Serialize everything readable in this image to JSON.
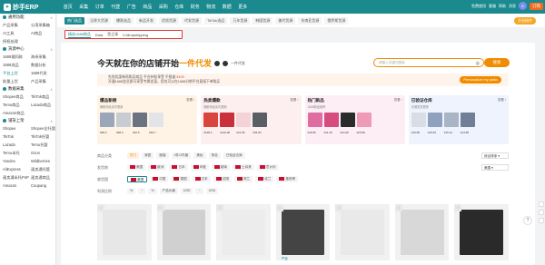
{
  "app": {
    "logo_text": "妙手ERP",
    "nav": [
      "首页",
      "采集",
      "订单",
      "刊登",
      "广告",
      "商品",
      "采购",
      "仓库",
      "财务",
      "物流",
      "数据",
      "更多"
    ],
    "top_right": {
      "items": [
        "免费使用",
        "客服",
        "帮助",
        "消息"
      ],
      "upgrade": "订购",
      "avatar": "A"
    }
  },
  "sidebar": {
    "sections": [
      {
        "title": "通用功能",
        "items": [
          "产品采集",
          "公用采集箱",
          "AI工具",
          "AI商品",
          "授权处理",
          ""
        ]
      },
      {
        "title": "货源中心",
        "items": [
          "1688搜同款",
          "海采采集",
          "1688选品",
          "数据分析",
          "平台上货",
          "1688代发",
          "批量上货",
          "产品采集"
        ],
        "active_index": 4
      },
      {
        "title": "数据采集",
        "items": [
          "Shopee商品",
          "TikTok商品",
          "Temu商品",
          "Lazada商品",
          "Amazon商品",
          ""
        ]
      },
      {
        "title": "铺货上架",
        "items": [
          "Shopee",
          "Shopee全托管",
          "TikTok",
          "TikTok托管",
          "Lazada",
          "Temu托管",
          "Temu半托",
          "Ozon",
          "Yandex",
          "Wildberries",
          "AliExpress",
          "速卖通托管",
          "速卖通半托PoP",
          "速卖通商品",
          "Amazon",
          "Coupang"
        ]
      }
    ]
  },
  "tabs": {
    "items": [
      "热门选品",
      "当季大货源",
      "爆款选品",
      "新品开发",
      "优质货源",
      "代发货源",
      "TikTok选品",
      "万年货源",
      "韩国货源",
      "美代货源",
      "东南亚货源",
      "俄罗斯货源"
    ],
    "active_index": 0,
    "plugin_label": "开启插件"
  },
  "subtabs": {
    "items": [
      "精选1688商品",
      "Dola",
      "货之采",
      "CJdropshipping"
    ],
    "active_index": 0
  },
  "hero": {
    "title_prefix": "今天就在你的店铺开始",
    "title_highlight": "一件代发",
    "subtitle": "一件代发",
    "search_placeholder": "请输入关键词搜索",
    "search_button": "搜索"
  },
  "promo": {
    "line1": "先领优惠券再购买商品 平台补贴享受 不限量",
    "line1_hl": "¥100",
    "line2": "开通1688会员即可享受专属优惠，您也可以在1688分销平台直接下单购买",
    "button": "Personalize my picks"
  },
  "cards": [
    {
      "title": "爆品新榜",
      "sub": "爆款商品实时更新",
      "more": "查看",
      "prices": [
        "¥98.4",
        "¥98.3",
        "¥62.5",
        "¥39.7"
      ],
      "bg": "#fff3e6"
    },
    {
      "title": "热卖爆款",
      "sub": "爆款商品实时更新",
      "more": "查看",
      "prices": [
        "¥138.4",
        "¥122.00",
        "¥41.96",
        "¥35.00"
      ],
      "bg": "#fdeff0"
    },
    {
      "title": "热门新品",
      "sub": "1688新品推荐",
      "more": "查看",
      "prices": [
        "¥49.65",
        "¥41.49",
        "¥24.99",
        "¥25.98"
      ],
      "bg": "#fdeef6"
    },
    {
      "title": "已验证仓库",
      "sub": "仓储发货更快",
      "more": "查看",
      "prices": [
        "¥19.58",
        "¥15.63",
        "¥15.12",
        "¥14.68"
      ],
      "bg": "#eef3fd"
    }
  ],
  "filters": {
    "row1": {
      "label": "商品分类",
      "chips": [
        "热门",
        "家居",
        "服装",
        "4件/2件套",
        "美妆",
        "饰品",
        "已验证仓库"
      ],
      "sort": "综合排序"
    },
    "row2": {
      "label": "发货地",
      "chips": [
        "美国",
        "欧洲",
        "日本",
        "印度",
        "越南",
        "土耳其",
        "意大利"
      ],
      "dropdown": "美国"
    },
    "row3": {
      "label": "收货国",
      "chips": [
        "美国",
        "中国",
        "德国",
        "日本",
        "法国",
        "荷兰",
        "波兰",
        "墨西哥"
      ]
    },
    "row4": {
      "label": "利润比例",
      "chips": [
        "%",
        "~",
        "%",
        "产品价格",
        "USD",
        "~",
        "USD"
      ]
    }
  },
  "products": [
    {
      "tag": ""
    },
    {
      "tag": ""
    },
    {
      "tag": ""
    },
    {
      "tag": "严选"
    },
    {
      "tag": ""
    },
    {
      "tag": ""
    },
    {
      "tag": ""
    }
  ],
  "colors": {
    "brand": "#1a8a8f",
    "accent": "#f08c00",
    "alert": "#e53935"
  }
}
